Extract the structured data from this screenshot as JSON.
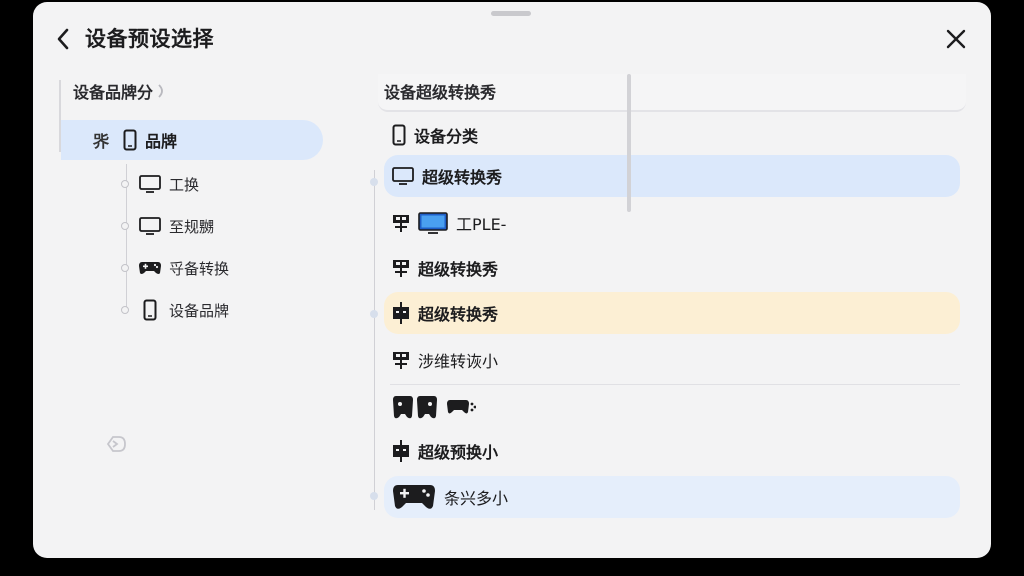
{
  "header": {
    "title": "设备预设选择",
    "back_icon": "chevron-left-icon",
    "close_icon": "close-icon"
  },
  "left_panel": {
    "header": "设备品牌分",
    "brand_row": {
      "lead": "㖎",
      "icon": "phone-icon",
      "label": "品牌"
    },
    "items": [
      {
        "icon": "monitor-icon",
        "label": "工换"
      },
      {
        "icon": "monitor-icon",
        "label": "至规嬲"
      },
      {
        "icon": "gamepad-icon",
        "label": "寽备转换"
      },
      {
        "icon": "phone-icon",
        "label": "设备品牌"
      }
    ]
  },
  "right_panel": {
    "header": "设备超级转换秀",
    "items": [
      {
        "icon": "phone-icon",
        "label": "设备分类"
      },
      {
        "icon": "monitor-icon",
        "label": "超级转换秀"
      },
      {
        "icon": "device-glyph-icon",
        "label": "工PLE-"
      },
      {
        "icon": "device-glyph-icon",
        "label": "超级转换秀"
      },
      {
        "icon": "device-glyph-icon",
        "label": "超级转换秀"
      },
      {
        "icon": "device-glyph-icon",
        "label": "涉维转诙小"
      },
      {
        "icon": "gamepad-icon",
        "label": ""
      },
      {
        "icon": "device-glyph-icon",
        "label": "超级预换小"
      },
      {
        "icon": "gamepad-icon",
        "label": "条兴多小"
      }
    ]
  },
  "colors": {
    "sheet": "#f3f3f4",
    "selected_blue": "#dbe8fb",
    "selected_yellow": "#fcefd4",
    "text": "#1c1c1e"
  }
}
